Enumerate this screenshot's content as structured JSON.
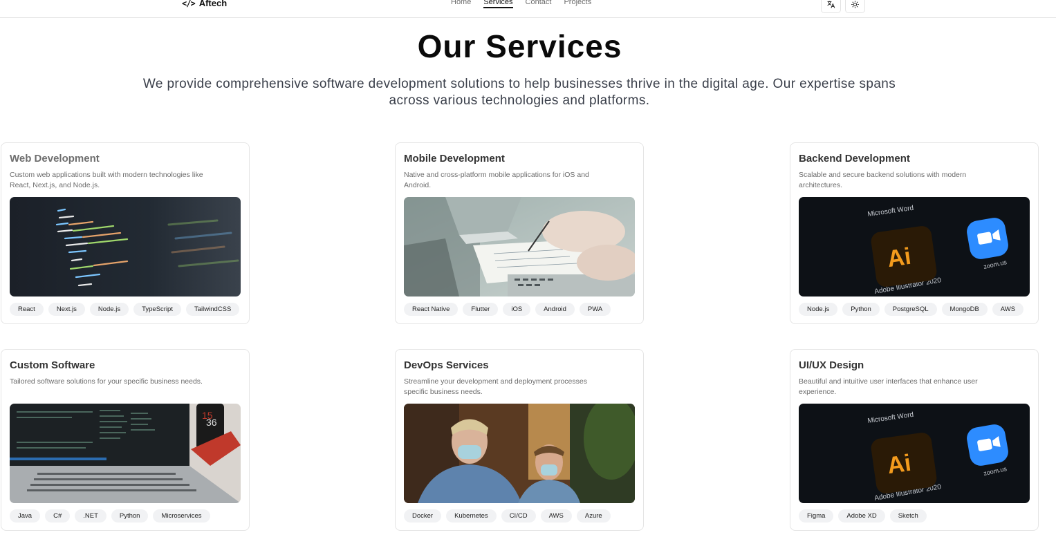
{
  "header": {
    "brand": "Aftech",
    "brand_icon": "code-icon",
    "nav": [
      "Home",
      "Services",
      "Contact",
      "Projects"
    ],
    "active_nav": "Services",
    "buttons": [
      "translate-icon",
      "sun-icon"
    ]
  },
  "hero": {
    "title": "Our Services",
    "subtitle": "We provide comprehensive software development solutions to help businesses thrive in the digital age. Our expertise spans across various technologies and platforms."
  },
  "services": [
    {
      "title": "Web Development",
      "description": "Custom web applications built with modern technologies like React, Next.js, and Node.js.",
      "image": "code-on-monitor-photo",
      "tags": [
        "React",
        "Next.js",
        "Node.js",
        "TypeScript",
        "TailwindCSS"
      ]
    },
    {
      "title": "Mobile Development",
      "description": "Native and cross-platform mobile applications for iOS and Android.",
      "image": "hands-writing-at-laptop-photo",
      "tags": [
        "React Native",
        "Flutter",
        "iOS",
        "Android",
        "PWA"
      ]
    },
    {
      "title": "Backend Development",
      "description": "Scalable and secure backend solutions with modern architectures.",
      "image": "app-icons-screen-photo",
      "image_text": [
        "Microsoft Word",
        "Adobe Illustrator 2020",
        "zoom.us",
        "Ai"
      ],
      "tags": [
        "Node.js",
        "Python",
        "PostgreSQL",
        "MongoDB",
        "AWS"
      ]
    },
    {
      "title": "Custom Software",
      "description": "Tailored software solutions for your specific business needs.",
      "image": "laptop-with-terminal-photo",
      "tags": [
        "Java",
        "C#",
        ".NET",
        "Python",
        "Microservices"
      ]
    },
    {
      "title": "DevOps Services",
      "description": "Streamline your development and deployment processes specific business needs.",
      "image": "two-people-with-masks-photo",
      "tags": [
        "Docker",
        "Kubernetes",
        "CI/CD",
        "AWS",
        "Azure"
      ]
    },
    {
      "title": "UI/UX Design",
      "description": "Beautiful and intuitive user interfaces that enhance user experience.",
      "image": "app-icons-screen-photo",
      "image_text": [
        "Microsoft Word",
        "Adobe Illustrator 2020",
        "zoom.us",
        "Ai"
      ],
      "tags": [
        "Figma",
        "Adobe XD",
        "Sketch"
      ]
    }
  ],
  "colors": {
    "text": "#0a0a0a",
    "muted": "#6b6b6b",
    "tag_bg": "#f1f2f4",
    "border": "#e5e5e5"
  }
}
